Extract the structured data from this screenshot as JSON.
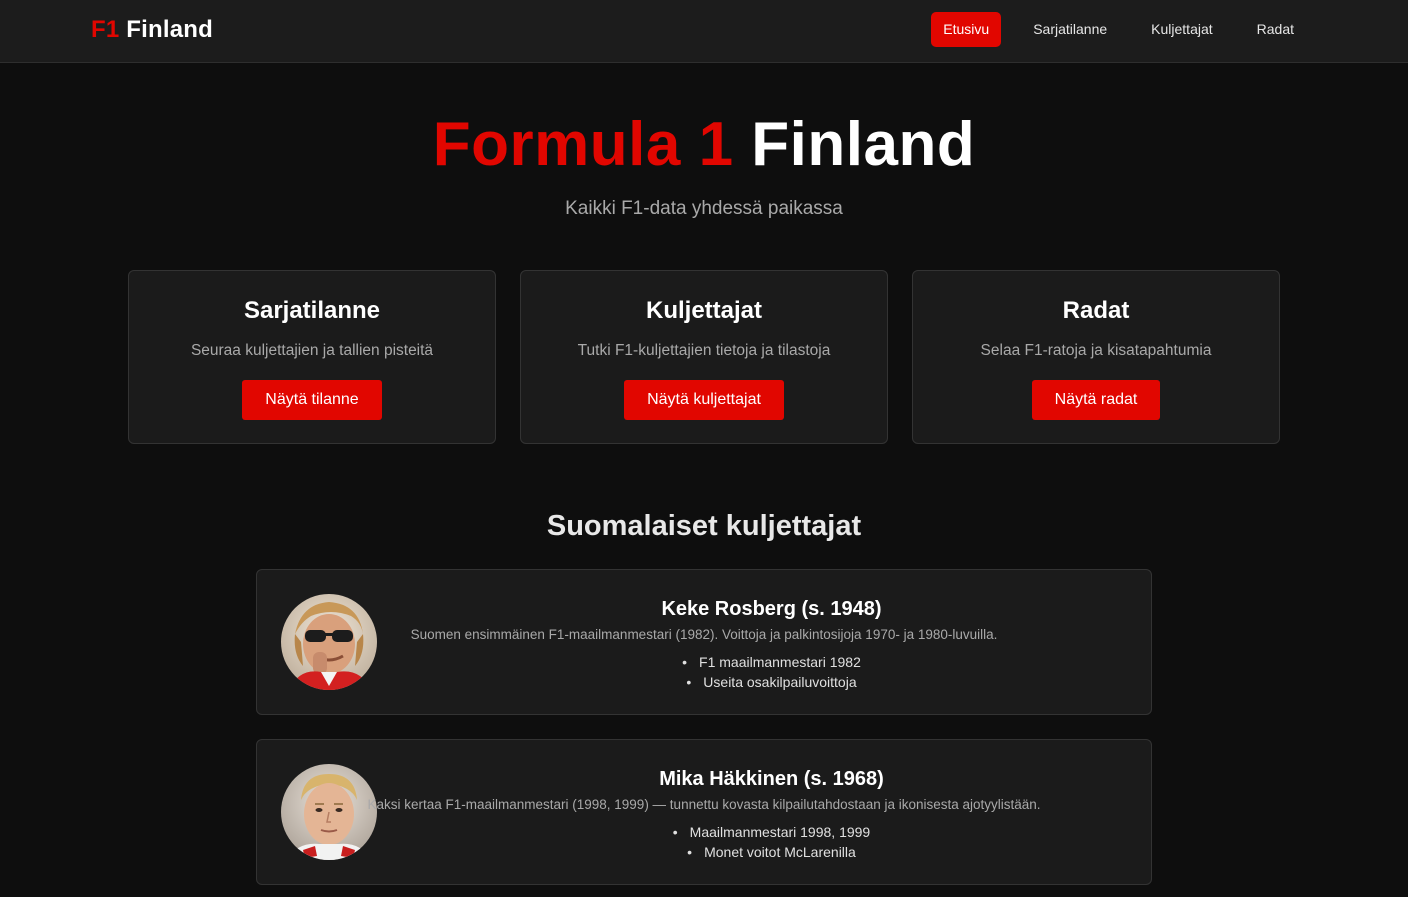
{
  "header": {
    "logo_prefix": "F1",
    "logo_suffix": "Finland",
    "nav": [
      {
        "label": "Etusivu",
        "active": true
      },
      {
        "label": "Sarjatilanne",
        "active": false
      },
      {
        "label": "Kuljettajat",
        "active": false
      },
      {
        "label": "Radat",
        "active": false
      }
    ]
  },
  "hero": {
    "title_red": "Formula 1",
    "title_white": "Finland",
    "subtitle": "Kaikki F1-data yhdessä paikassa"
  },
  "cards": [
    {
      "title": "Sarjatilanne",
      "description": "Seuraa kuljettajien ja tallien pisteitä",
      "button": "Näytä tilanne"
    },
    {
      "title": "Kuljettajat",
      "description": "Tutki F1-kuljettajien tietoja ja tilastoja",
      "button": "Näytä kuljettajat"
    },
    {
      "title": "Radat",
      "description": "Selaa F1-ratoja ja kisatapahtumia",
      "button": "Näytä radat"
    }
  ],
  "drivers_section": {
    "title": "Suomalaiset kuljettajat",
    "drivers": [
      {
        "name": "Keke Rosberg (s. 1948)",
        "description": "Suomen ensimmäinen F1-maailmanmestari (1982). Voittoja ja palkintosijoja 1970- ja 1980-luvuilla.",
        "facts": [
          "F1 maailmanmestari 1982",
          "Useita osakilpailuvoittoja"
        ]
      },
      {
        "name": "Mika Häkkinen (s. 1968)",
        "description": "Kaksi kertaa F1-maailmanmestari (1998, 1999) — tunnettu kovasta kilpailutahdostaan ja ikonisesta ajotyylistään.",
        "facts": [
          "Maailmanmestari 1998, 1999",
          "Monet voitot McLarenilla"
        ]
      }
    ]
  },
  "colors": {
    "accent": "#e10600",
    "background": "#0e0e0e",
    "card": "#1b1b1b"
  }
}
